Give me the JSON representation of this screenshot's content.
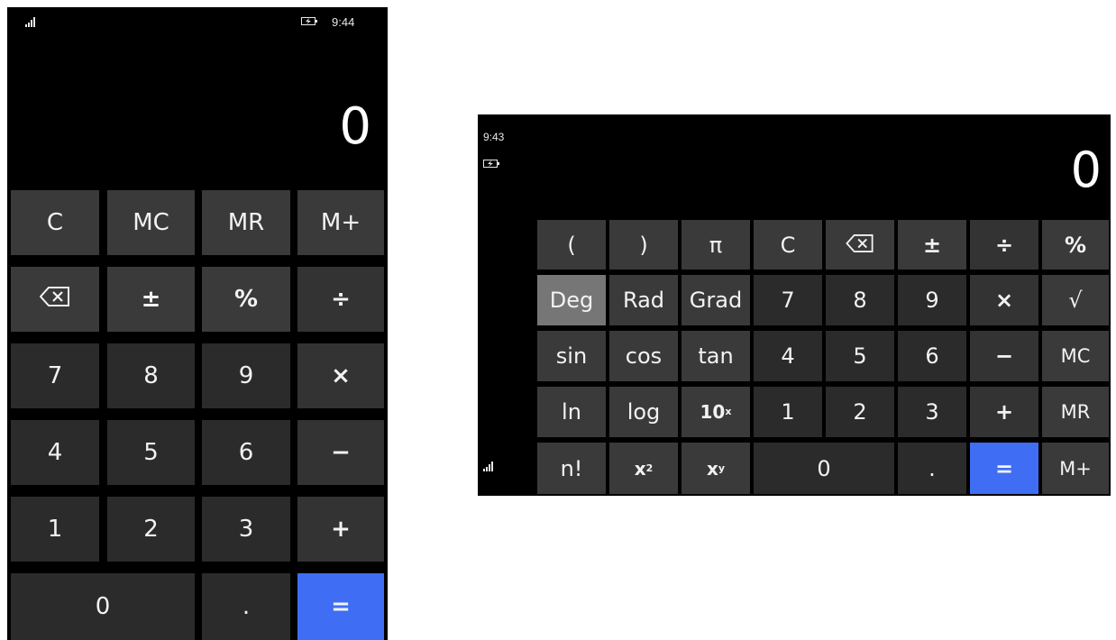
{
  "portrait": {
    "status": {
      "time": "9:44",
      "battery_icon": "battery-charging-icon",
      "signal_icon": "signal-strength-icon"
    },
    "display_value": "0",
    "keys": {
      "c": "C",
      "mc": "MC",
      "mr": "MR",
      "mplus": "M+",
      "backspace_icon": "backspace-icon",
      "plusminus": "±",
      "percent": "%",
      "divide": "÷",
      "seven": "7",
      "eight": "8",
      "nine": "9",
      "multiply": "×",
      "four": "4",
      "five": "5",
      "six": "6",
      "minus": "−",
      "one": "1",
      "two": "2",
      "three": "3",
      "plus": "+",
      "zero": "0",
      "dot": ".",
      "equals": "="
    }
  },
  "landscape": {
    "status": {
      "time": "9:43",
      "battery_icon": "battery-charging-icon",
      "signal_icon": "signal-strength-icon"
    },
    "display_value": "0",
    "keys": {
      "lparen": "(",
      "rparen": ")",
      "pi": "π",
      "c": "C",
      "backspace_icon": "backspace-icon",
      "plusminus": "±",
      "divide": "÷",
      "percent": "%",
      "deg": "Deg",
      "rad": "Rad",
      "grad": "Grad",
      "seven": "7",
      "eight": "8",
      "nine": "9",
      "multiply": "×",
      "sqrt": "√",
      "sin": "sin",
      "cos": "cos",
      "tan": "tan",
      "four": "4",
      "five": "5",
      "six": "6",
      "minus": "−",
      "mc": "MC",
      "ln": "ln",
      "log": "log",
      "ten_base": "10",
      "ten_exp": "x",
      "one": "1",
      "two": "2",
      "three": "3",
      "plus": "+",
      "mr": "MR",
      "factorial": "n!",
      "x2_base": "x",
      "x2_exp": "2",
      "xy_base": "x",
      "xy_exp": "y",
      "zero": "0",
      "dot": ".",
      "equals": "=",
      "mplus": "M+"
    }
  },
  "colors": {
    "equals_key": "#3f6ef5",
    "selected_mode": "#767676",
    "screen": "#000000"
  }
}
